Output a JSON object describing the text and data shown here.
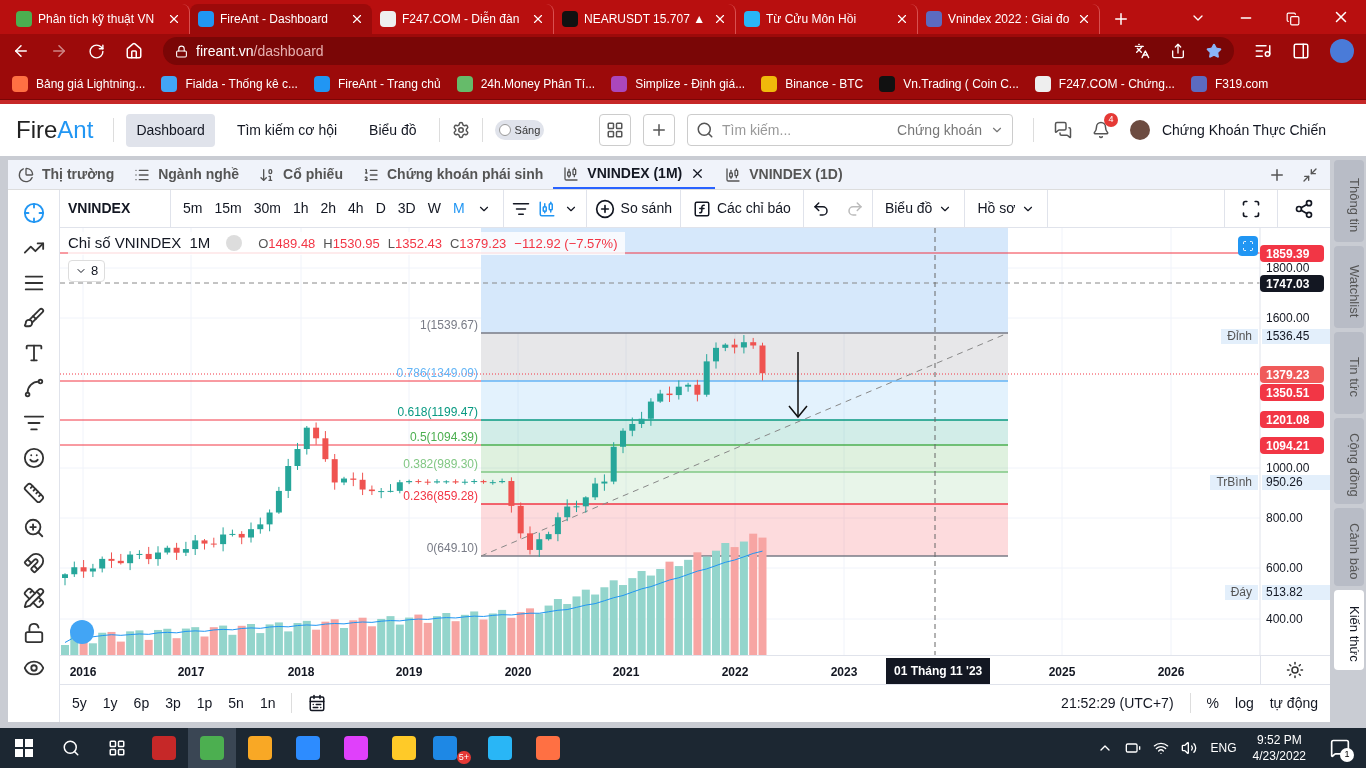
{
  "browser": {
    "tabs": [
      {
        "title": "Phân tích kỹ thuật VN",
        "selected": false,
        "color": "#4caf50"
      },
      {
        "title": "FireAnt - Dashboard",
        "selected": true,
        "color": "#2196f3"
      },
      {
        "title": "F247.COM - Diễn đàn",
        "selected": false,
        "color": "#eeeeee"
      },
      {
        "title": "NEARUSDT 15.707 ▲",
        "selected": false,
        "color": "#111111"
      },
      {
        "title": "Từ Cửu Môn Hồi",
        "selected": false,
        "color": "#29b6f6"
      },
      {
        "title": "Vnindex 2022 : Giai đo",
        "selected": false,
        "color": "#5c6bc0"
      }
    ],
    "url_host": "fireant.vn",
    "url_path": "/dashboard",
    "bookmarks": [
      {
        "title": "Bảng giá Lightning...",
        "color": "#ff7043"
      },
      {
        "title": "Fialda - Thống kê c...",
        "color": "#42a5f5"
      },
      {
        "title": "FireAnt - Trang chủ",
        "color": "#2196f3"
      },
      {
        "title": "24h.Money Phân Tí...",
        "color": "#66bb6a"
      },
      {
        "title": "Simplize - Định giá...",
        "color": "#ab47bc"
      },
      {
        "title": "Binance - BTC",
        "color": "#f0b90b"
      },
      {
        "title": "Vn.Trading ( Coin C...",
        "color": "#111111"
      },
      {
        "title": "F247.COM - Chứng...",
        "color": "#eeeeee"
      },
      {
        "title": "F319.com",
        "color": "#5c6bc0"
      }
    ]
  },
  "app": {
    "logo_first": "Fire",
    "logo_second": "Ant",
    "nav": [
      {
        "label": "Dashboard",
        "selected": true
      },
      {
        "label": "Tìm kiếm cơ hội",
        "selected": false
      },
      {
        "label": "Biểu đồ",
        "selected": false
      }
    ],
    "theme_toggle": {
      "label": "Sáng",
      "on": false
    },
    "search": {
      "placeholder": "Tìm kiếm...",
      "scope": "Chứng khoán"
    },
    "notification_count": "4",
    "user": "Chứng Khoán Thực Chiến"
  },
  "panel_tabs": [
    {
      "label": "Thị trường",
      "kind": "pie",
      "selected": false,
      "closable": false
    },
    {
      "label": "Ngành nghề",
      "kind": "list",
      "selected": false,
      "closable": false
    },
    {
      "label": "Cổ phiếu",
      "kind": "sort",
      "selected": false,
      "closable": false
    },
    {
      "label": "Chứng khoán phái sinh",
      "kind": "ordered",
      "selected": false,
      "closable": false
    },
    {
      "label": "VNINDEX (1M)",
      "kind": "chart",
      "selected": true,
      "closable": true
    },
    {
      "label": "VNINDEX (1D)",
      "kind": "chart",
      "selected": false,
      "closable": false
    }
  ],
  "chart_toolbar": {
    "symbol": "VNINDEX",
    "intervals": [
      {
        "label": "5m",
        "selected": false
      },
      {
        "label": "15m",
        "selected": false
      },
      {
        "label": "30m",
        "selected": false
      },
      {
        "label": "1h",
        "selected": false
      },
      {
        "label": "2h",
        "selected": false
      },
      {
        "label": "4h",
        "selected": false
      },
      {
        "label": "D",
        "selected": false
      },
      {
        "label": "3D",
        "selected": false
      },
      {
        "label": "W",
        "selected": false
      },
      {
        "label": "M",
        "selected": true
      }
    ],
    "compare": "So sánh",
    "indicators": "Các chỉ báo",
    "menus": [
      "Biểu đồ",
      "Hồ sơ"
    ]
  },
  "chart": {
    "title": "Chỉ số VNINDEX",
    "interval": "1M",
    "ohlc": [
      {
        "key": "O",
        "value": "1489.48"
      },
      {
        "key": "H",
        "value": "1530.95"
      },
      {
        "key": "L",
        "value": "1352.43"
      },
      {
        "key": "C",
        "value": "1379.23"
      }
    ],
    "change": "−112.92 (−7.57%)",
    "collapsed_count": "8",
    "fib_levels": [
      {
        "label": "1(1539.67)",
        "color": "#787b86"
      },
      {
        "label": "0.786(1349.09)",
        "color": "#64b5f6"
      },
      {
        "label": "0.618(1199.47)",
        "color": "#089981"
      },
      {
        "label": "0.5(1094.39)",
        "color": "#4caf50"
      },
      {
        "label": "0.382(989.30)",
        "color": "#81c784"
      },
      {
        "label": "0.236(859.28)",
        "color": "#f23645"
      },
      {
        "label": "0(649.10)",
        "color": "#787b86"
      }
    ],
    "price_ticks": [
      "1800.00",
      "1600.00",
      "1000.00",
      "800.00",
      "600.00",
      "400.00"
    ],
    "price_tags": [
      {
        "value": "1859.39",
        "color": "#f23645"
      },
      {
        "value": "1747.03",
        "color": "#131722"
      },
      {
        "value": "1379.23",
        "color": "#f05a5a"
      },
      {
        "value": "1350.51",
        "color": "#f23645"
      },
      {
        "value": "1201.08",
        "color": "#f23645"
      },
      {
        "value": "1094.21",
        "color": "#f23645"
      }
    ],
    "markers": [
      {
        "label": "Đỉnh",
        "value": "1536.45"
      },
      {
        "label": "TrBình",
        "value": "950.26"
      },
      {
        "label": "Đáy",
        "value": "513.82"
      }
    ],
    "years": [
      "2016",
      "2017",
      "2018",
      "2019",
      "2020",
      "2021",
      "2022",
      "2023",
      "2025",
      "2026"
    ],
    "cursor_date": "01 Tháng 11 '23"
  },
  "ranges": [
    "5y",
    "1y",
    "6p",
    "3p",
    "1p",
    "5n",
    "1n"
  ],
  "clock": "21:52:29 (UTC+7)",
  "scale_options": [
    "%",
    "log",
    "tự động"
  ],
  "side_tabs": [
    {
      "label": "Thông tin",
      "selected": false
    },
    {
      "label": "Watchlist",
      "selected": false
    },
    {
      "label": "Tin tức",
      "selected": false
    },
    {
      "label": "Cộng đồng",
      "selected": false
    },
    {
      "label": "Cảnh báo",
      "selected": false
    },
    {
      "label": "Kiến thức",
      "selected": true
    }
  ],
  "taskbar": {
    "zalo_badge": "5+",
    "language": "ENG",
    "time": "9:52 PM",
    "date": "4/23/2022",
    "notification_count": "1"
  }
}
